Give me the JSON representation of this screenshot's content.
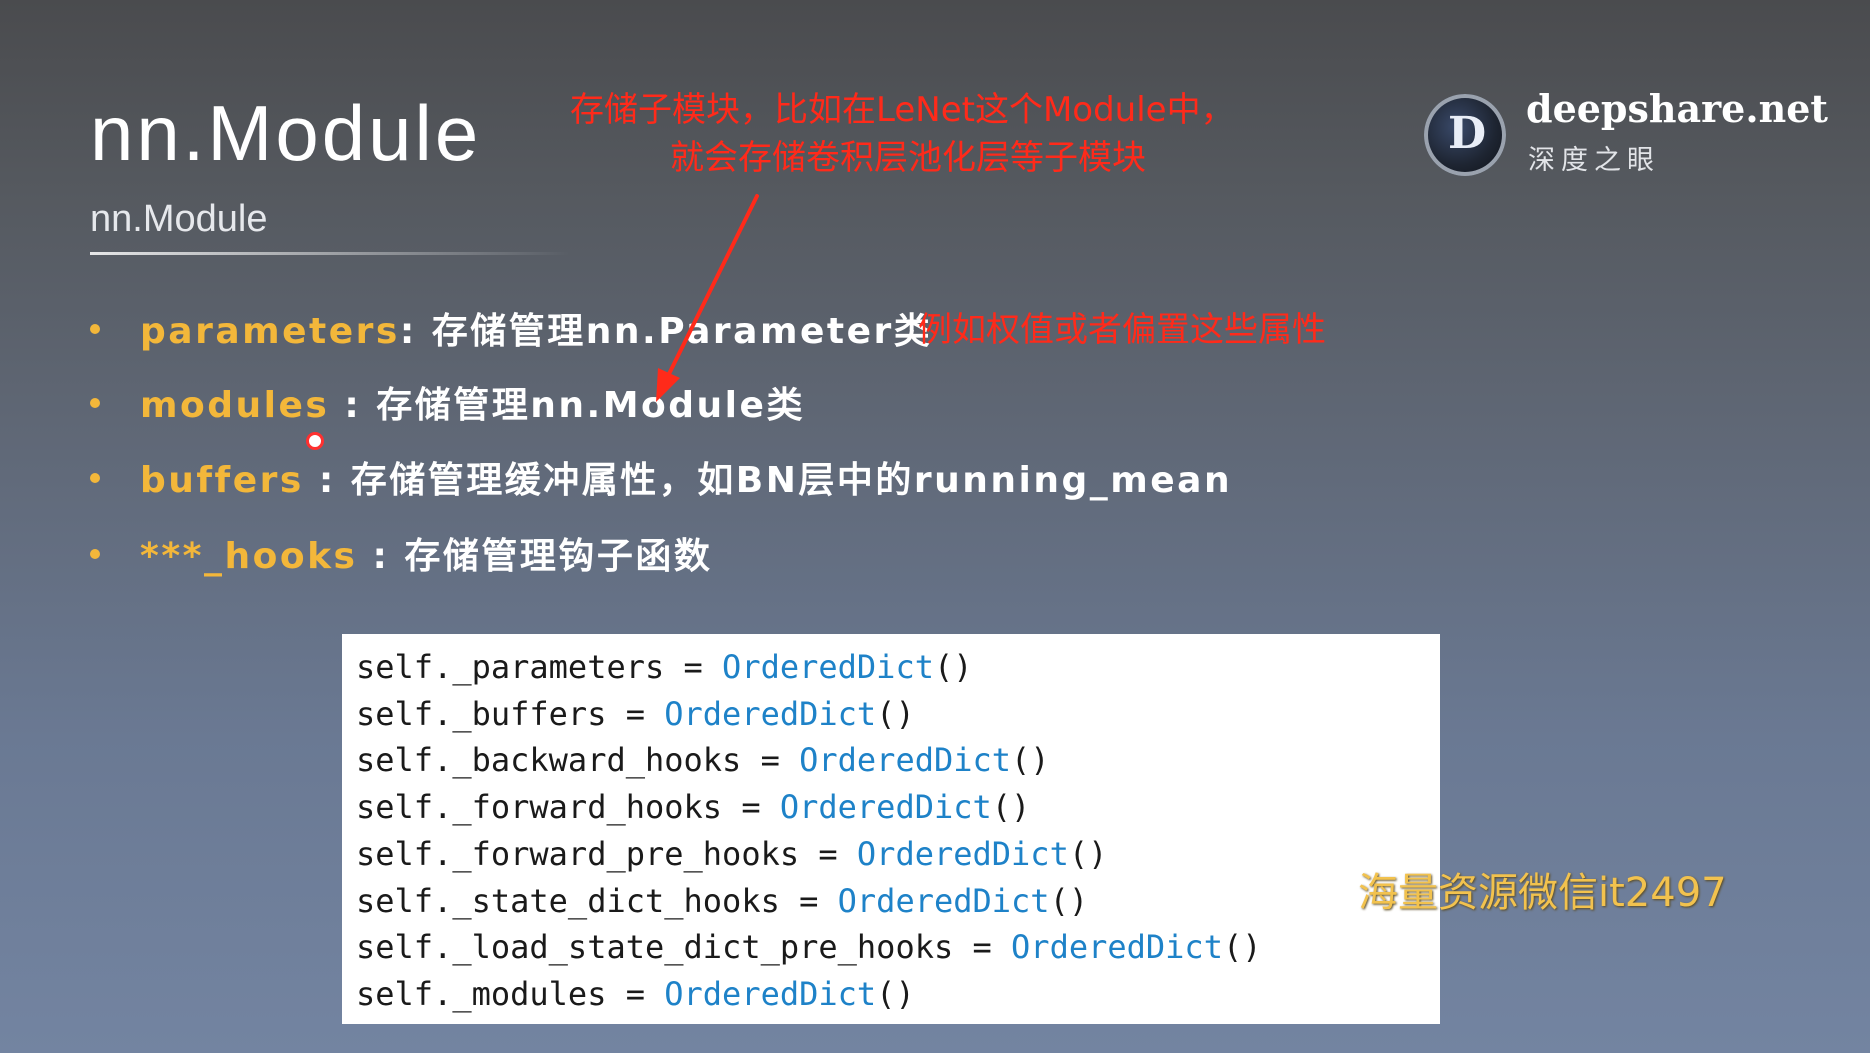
{
  "slide": {
    "title": "nn.Module",
    "subtitle": "nn.Module"
  },
  "annotations": {
    "top_line_1": "存储子模块，比如在LeNet这个Module中，",
    "top_line_2": "就会存储卷积层池化层等子模块",
    "row1_note": "例如权值或者偏置这些属性"
  },
  "brand": {
    "logo_letter": "D",
    "name": "deepshare.net",
    "tagline": "深度之眼"
  },
  "bullets": [
    {
      "keyword": "parameters",
      "sep": ": ",
      "desc": "存储管理nn.Parameter类"
    },
    {
      "keyword": "modules",
      "sep": " : ",
      "desc": "存储管理nn.Module类"
    },
    {
      "keyword": "buffers",
      "sep": " : ",
      "desc": "存储管理缓冲属性，如BN层中的running_mean"
    },
    {
      "keyword": "***_hooks",
      "sep": " : ",
      "desc": "存储管理钩子函数"
    }
  ],
  "code": [
    {
      "self": "self",
      "dot": ".",
      "attr": "_parameters",
      "eq": " = ",
      "cls": "OrderedDict",
      "paren": "()"
    },
    {
      "self": "self",
      "dot": ".",
      "attr": "_buffers",
      "eq": " = ",
      "cls": "OrderedDict",
      "paren": "()"
    },
    {
      "self": "self",
      "dot": ".",
      "attr": "_backward_hooks",
      "eq": " = ",
      "cls": "OrderedDict",
      "paren": "()"
    },
    {
      "self": "self",
      "dot": ".",
      "attr": "_forward_hooks",
      "eq": " = ",
      "cls": "OrderedDict",
      "paren": "()"
    },
    {
      "self": "self",
      "dot": ".",
      "attr": "_forward_pre_hooks",
      "eq": " = ",
      "cls": "OrderedDict",
      "paren": "()"
    },
    {
      "self": "self",
      "dot": ".",
      "attr": "_state_dict_hooks",
      "eq": " = ",
      "cls": "OrderedDict",
      "paren": "()"
    },
    {
      "self": "self",
      "dot": ".",
      "attr": "_load_state_dict_pre_hooks",
      "eq": " = ",
      "cls": "OrderedDict",
      "paren": "()"
    },
    {
      "self": "self",
      "dot": ".",
      "attr": "_modules",
      "eq": " = ",
      "cls": "OrderedDict",
      "paren": "()"
    }
  ],
  "watermark": "海量资源微信it2497",
  "colors": {
    "keyword": "#f3b73a",
    "annotation": "#ff2a1a",
    "code_class": "#1e82c8"
  }
}
